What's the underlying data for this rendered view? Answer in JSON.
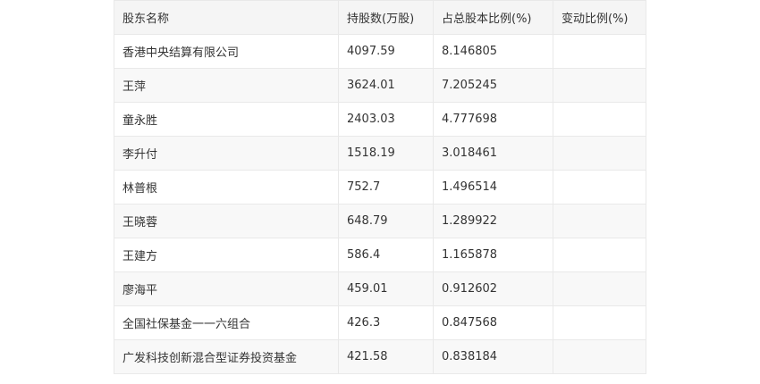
{
  "table": {
    "headers": [
      "股东名称",
      "持股数(万股)",
      "占总股本比例(%)",
      "变动比例(%)"
    ],
    "rows": [
      {
        "name": "香港中央结算有限公司",
        "shares": "4097.59",
        "ratio": "8.146805",
        "change": ""
      },
      {
        "name": "王萍",
        "shares": "3624.01",
        "ratio": "7.205245",
        "change": ""
      },
      {
        "name": "童永胜",
        "shares": "2403.03",
        "ratio": "4.777698",
        "change": ""
      },
      {
        "name": "李升付",
        "shares": "1518.19",
        "ratio": "3.018461",
        "change": ""
      },
      {
        "name": "林普根",
        "shares": "752.7",
        "ratio": "1.496514",
        "change": ""
      },
      {
        "name": "王晓蓉",
        "shares": "648.79",
        "ratio": "1.289922",
        "change": ""
      },
      {
        "name": "王建方",
        "shares": "586.4",
        "ratio": "1.165878",
        "change": ""
      },
      {
        "name": "廖海平",
        "shares": "459.01",
        "ratio": "0.912602",
        "change": ""
      },
      {
        "name": "全国社保基金一一六组合",
        "shares": "426.3",
        "ratio": "0.847568",
        "change": ""
      },
      {
        "name": "广发科技创新混合型证券投资基金",
        "shares": "421.58",
        "ratio": "0.838184",
        "change": ""
      }
    ]
  }
}
